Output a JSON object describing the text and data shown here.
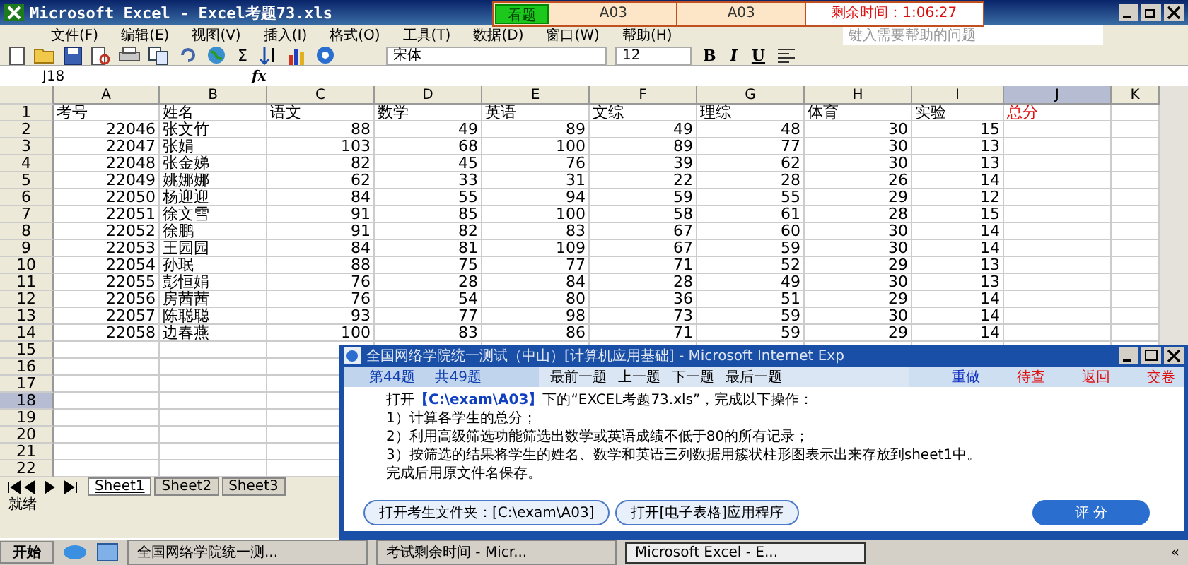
{
  "window": {
    "title": "Microsoft Excel - Excel考题73.xls"
  },
  "exam_bar": {
    "view_button": "看题",
    "code_1": "A03",
    "code_2": "A03",
    "timer": "剩余时间：1:06:27"
  },
  "menu": [
    "文件(F)",
    "编辑(E)",
    "视图(V)",
    "插入(I)",
    "格式(O)",
    "工具(T)",
    "数据(D)",
    "窗口(W)",
    "帮助(H)"
  ],
  "help_search": {
    "placeholder": "键入需要帮助的问题"
  },
  "toolbar": {
    "sum": "Σ",
    "font": "宋体",
    "size": "12",
    "format_buttons": [
      "B",
      "I",
      "U"
    ]
  },
  "formula_bar": {
    "cell": "J18",
    "fx_label": "fx"
  },
  "sheet": {
    "columns": [
      {
        "letter": "A",
        "selected": false
      },
      {
        "letter": "B",
        "selected": false
      },
      {
        "letter": "C",
        "selected": false
      },
      {
        "letter": "D",
        "selected": false
      },
      {
        "letter": "E",
        "selected": false
      },
      {
        "letter": "F",
        "selected": false
      },
      {
        "letter": "G",
        "selected": false
      },
      {
        "letter": "H",
        "selected": false
      },
      {
        "letter": "I",
        "selected": false
      },
      {
        "letter": "J",
        "selected": true
      },
      {
        "letter": "K",
        "selected": false
      }
    ],
    "rows": [
      {
        "number": "1",
        "selected": false,
        "kind": "header",
        "cells": [
          {
            "text": "考号",
            "alert": false
          },
          {
            "text": "姓名",
            "alert": false
          },
          {
            "text": "语文",
            "alert": false
          },
          {
            "text": "数学",
            "alert": false
          },
          {
            "text": "英语",
            "alert": false
          },
          {
            "text": "文综",
            "alert": false
          },
          {
            "text": "理综",
            "alert": false
          },
          {
            "text": "体育",
            "alert": false
          },
          {
            "text": "实验",
            "alert": false
          },
          {
            "text": "总分",
            "alert": true
          }
        ]
      },
      {
        "number": "2",
        "selected": false,
        "kind": "data",
        "cells": [
          "22046",
          "张文竹",
          "88",
          "49",
          "89",
          "49",
          "48",
          "30",
          "15"
        ]
      },
      {
        "number": "3",
        "selected": false,
        "kind": "data",
        "cells": [
          "22047",
          "张娟",
          "103",
          "68",
          "100",
          "89",
          "77",
          "30",
          "13"
        ]
      },
      {
        "number": "4",
        "selected": false,
        "kind": "data",
        "cells": [
          "22048",
          "张金娣",
          "82",
          "45",
          "76",
          "39",
          "62",
          "30",
          "13"
        ]
      },
      {
        "number": "5",
        "selected": false,
        "kind": "data",
        "cells": [
          "22049",
          "姚娜娜",
          "62",
          "33",
          "31",
          "22",
          "28",
          "26",
          "14"
        ]
      },
      {
        "number": "6",
        "selected": false,
        "kind": "data",
        "cells": [
          "22050",
          "杨迎迎",
          "84",
          "55",
          "94",
          "59",
          "55",
          "29",
          "12"
        ]
      },
      {
        "number": "7",
        "selected": false,
        "kind": "data",
        "cells": [
          "22051",
          "徐文雪",
          "91",
          "85",
          "100",
          "58",
          "61",
          "28",
          "15"
        ]
      },
      {
        "number": "8",
        "selected": false,
        "kind": "data",
        "cells": [
          "22052",
          "徐鹏",
          "91",
          "82",
          "83",
          "67",
          "60",
          "30",
          "14"
        ]
      },
      {
        "number": "9",
        "selected": false,
        "kind": "data",
        "cells": [
          "22053",
          "王园园",
          "84",
          "81",
          "109",
          "67",
          "59",
          "30",
          "14"
        ]
      },
      {
        "number": "10",
        "selected": false,
        "kind": "data",
        "cells": [
          "22054",
          "孙珉",
          "88",
          "75",
          "77",
          "71",
          "52",
          "29",
          "13"
        ]
      },
      {
        "number": "11",
        "selected": false,
        "kind": "data",
        "cells": [
          "22055",
          "彭恒娟",
          "76",
          "28",
          "84",
          "28",
          "49",
          "30",
          "13"
        ]
      },
      {
        "number": "12",
        "selected": false,
        "kind": "data",
        "cells": [
          "22056",
          "房茜茜",
          "76",
          "54",
          "80",
          "36",
          "51",
          "29",
          "14"
        ]
      },
      {
        "number": "13",
        "selected": false,
        "kind": "data",
        "cells": [
          "22057",
          "陈聪聪",
          "93",
          "77",
          "98",
          "73",
          "59",
          "30",
          "14"
        ]
      },
      {
        "number": "14",
        "selected": false,
        "kind": "data",
        "cells": [
          "22058",
          "边春燕",
          "100",
          "83",
          "86",
          "71",
          "59",
          "29",
          "14"
        ]
      },
      {
        "number": "15",
        "selected": false,
        "cells": []
      },
      {
        "number": "16",
        "selected": false,
        "cells": []
      },
      {
        "number": "17",
        "selected": false,
        "cells": []
      },
      {
        "number": "18",
        "selected": true,
        "cells": []
      },
      {
        "number": "19",
        "selected": false,
        "cells": []
      },
      {
        "number": "20",
        "selected": false,
        "cells": []
      },
      {
        "number": "21",
        "selected": false,
        "cells": []
      },
      {
        "number": "22",
        "selected": false,
        "cells": []
      }
    ],
    "tabs": [
      {
        "label": "Sheet1",
        "selected": true
      },
      {
        "label": "Sheet2",
        "selected": false
      },
      {
        "label": "Sheet3",
        "selected": false
      }
    ]
  },
  "status_bar": "就绪",
  "dialog": {
    "title": "全国网络学院统一测试（中山）[计算机应用基础] - Microsoft Internet Exp",
    "question_number": "第44题",
    "question_total": "共49题",
    "nav": [
      "最前一题",
      "上一题",
      "下一题",
      "最后一题"
    ],
    "actions": [
      {
        "label": "重做",
        "color": "#1030c0"
      },
      {
        "label": "待查",
        "color": "#e01010"
      },
      {
        "label": "返回",
        "color": "#e01010"
      },
      {
        "label": "交卷",
        "color": "#e01010"
      }
    ],
    "lines": [
      "打开**【C:\\exam\\A03】**下的“EXCEL考题73.xls”，完成以下操作：",
      "1）计算各学生的总分；",
      "2）利用高级筛选功能筛选出数学或英语成绩不低于80的所有记录；",
      "3）按筛选的结果将学生的姓名、数学和英语三列数据用簇状柱形图表示出来存放到sheet1中。",
      "完成后用原文件名保存。"
    ],
    "buttons": [
      "打开考生文件夹：[C:\\exam\\A03]",
      "打开[电子表格]应用程序"
    ],
    "grade_button": "评 分"
  },
  "taskbar": {
    "start": "开始",
    "tasks": [
      {
        "label": "全国网络学院统一测...",
        "selected": false
      },
      {
        "label": "考试剩余时间 - Micr...",
        "selected": false
      },
      {
        "label": "Microsoft Excel - E...",
        "selected": true
      }
    ],
    "tray": "«"
  }
}
